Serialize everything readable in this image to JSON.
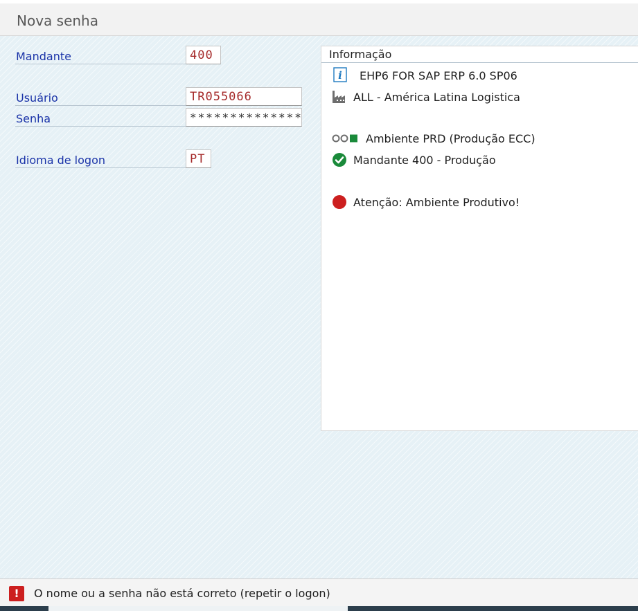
{
  "window": {
    "title": "Nova senha"
  },
  "form": {
    "client": {
      "label": "Mandante",
      "value": "400"
    },
    "user": {
      "label": "Usuário",
      "value": "TR055066"
    },
    "password": {
      "label": "Senha",
      "value": "**************"
    },
    "language": {
      "label": "Idioma de logon",
      "value": "PT"
    }
  },
  "info": {
    "title": "Informação",
    "lines": [
      {
        "icon": "info-icon",
        "text": "EHP6 FOR SAP ERP 6.0 SP06"
      },
      {
        "icon": "factory-icon",
        "text": "ALL - América Latina Logistica"
      },
      {
        "icon": "traffic-status-icon",
        "text": "Ambiente PRD (Produção ECC)"
      },
      {
        "icon": "check-icon",
        "text": "Mandante 400 - Produção"
      },
      {
        "icon": "red-circle-icon",
        "text": "Atenção: Ambiente Produtivo!"
      }
    ]
  },
  "status": {
    "icon": "error-icon",
    "icon_glyph": "!",
    "message": "O nome ou a senha não está correto (repetir o logon)"
  },
  "colors": {
    "label_blue": "#1a33a8",
    "value_red": "#a52a2a",
    "ok_green": "#1a8a3a",
    "error_red": "#cc1f1f",
    "info_blue": "#1f7ac0"
  }
}
